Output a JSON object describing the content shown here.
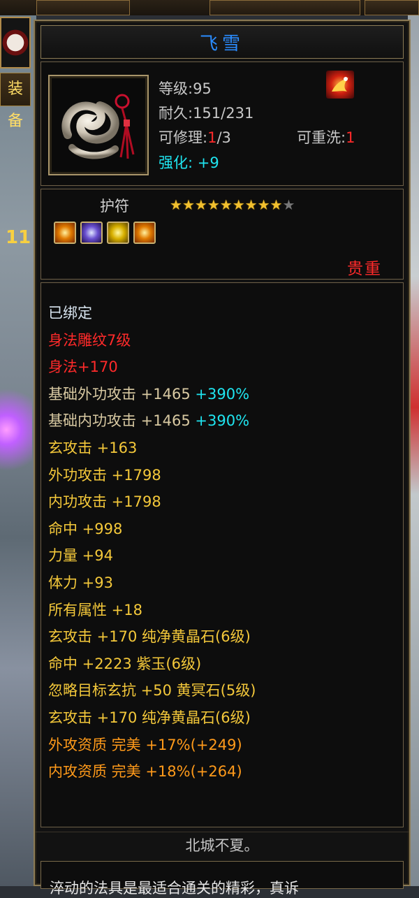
{
  "item": {
    "name": "飞雪",
    "level_label": "等级",
    "level_value": ":95",
    "durability_label": "耐久",
    "durability_value": ":151/231",
    "repair_label": "可修理",
    "repair_colon": ":",
    "repair_current": "1",
    "repair_total": "/3",
    "rewash_label": "可重洗",
    "rewash_colon": ":",
    "rewash_value": "1",
    "enhance_label": "强化",
    "enhance_value": ": +9",
    "type": "护符",
    "stars_total": 10,
    "stars_filled": 9,
    "star_glyph": "★",
    "gems": [
      "yellow-gem-icon",
      "purple-gem-icon",
      "gold-gem-icon",
      "yellow-gem-icon"
    ],
    "rarity": "贵重"
  },
  "attributes": {
    "bound": "已绑定",
    "carving": "身法雕纹7级",
    "agility": "身法+170",
    "base_outer_attack": {
      "text": "基础外功攻击 +1465",
      "pct": "+390%"
    },
    "base_inner_attack": {
      "text": "基础内功攻击 +1465",
      "pct": "+390%"
    },
    "lines": [
      "玄攻击 +163",
      "外功攻击 +1798",
      "内功攻击 +1798",
      "命中 +998",
      "力量 +94",
      "体力 +93",
      "所有属性 +18",
      "玄攻击 +170 纯净黄晶石(6级)",
      "命中 +2223 紫玉(6级)",
      "忽略目标玄抗 +50 黄冥石(5级)",
      "玄攻击 +170 纯净黄晶石(6级)"
    ],
    "outer_quality": "外攻资质  完美 +17%(+249)",
    "inner_quality": "内攻资质  完美 +18%(+264)"
  },
  "flavor": "北城不夏。",
  "bottom_text": "淬动的法具是最适合通关的精彩，真诉",
  "background": {
    "left_tab_label": "装备",
    "left_number": "11"
  },
  "colors": {
    "name": "#2a8cff",
    "red": "#ff2a2a",
    "cyan": "#1fe5f0",
    "yellow": "#f4c83a",
    "orange": "#ff9a1a",
    "frame": "#8c7b55"
  }
}
